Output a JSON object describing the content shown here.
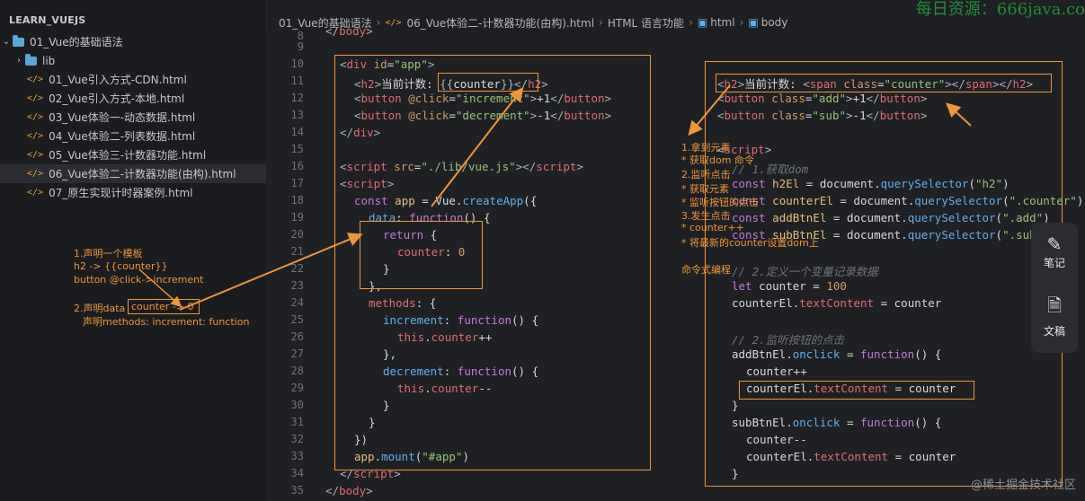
{
  "watermark_top": "每日资源：666java.co",
  "sidebar": {
    "title": "LEARN_VUEJS",
    "items": [
      {
        "label": "01_Vue的基础语法",
        "type": "folder-open"
      },
      {
        "label": "lib",
        "type": "folder"
      },
      {
        "label": "01_Vue引入方式-CDN.html",
        "type": "file"
      },
      {
        "label": "02_Vue引入方式-本地.html",
        "type": "file"
      },
      {
        "label": "03_Vue体验一-动态数据.html",
        "type": "file"
      },
      {
        "label": "04_Vue体验二-列表数据.html",
        "type": "file"
      },
      {
        "label": "05_Vue体验三-计数器功能.html",
        "type": "file"
      },
      {
        "label": "06_Vue体验二-计数器功能(由构).html",
        "type": "file"
      },
      {
        "label": "07_原生实现计时器案例.html",
        "type": "file"
      }
    ],
    "annotations": {
      "a1": "1.声明一个模板",
      "a2": "h2 -> {{counter}}",
      "a3": "button @click->increment",
      "a4": "2.声明data",
      "a5": "counter -> 0",
      "a6": "声明methods: increment: function"
    }
  },
  "breadcrumb": {
    "folder": "01_Vue的基础语法",
    "file": "06_Vue体验二-计数器功能(由构).html",
    "section": "HTML 语言功能",
    "html": "html",
    "body": "body"
  },
  "middle_annotations": {
    "b1": "1.拿到元素",
    "b2": "* 获取dom 命令",
    "b3": "2.监听点击",
    "b4": "* 获取元素",
    "b5": "* 监听按钮的点击",
    "b6": "3.发生点击",
    "b7": "* counter++",
    "b8": "* 将最新的counter设置dom上",
    "b9": "命令式编程"
  },
  "side_panel": {
    "notes_label": "笔记",
    "docs_label": "文稿"
  },
  "footer_watermark": "@稀土掘金技术社区"
}
